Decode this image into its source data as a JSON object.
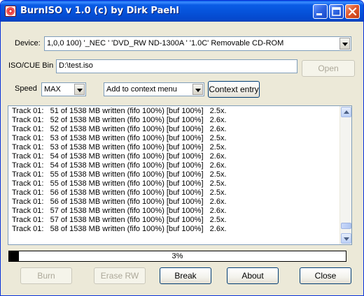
{
  "window": {
    "title": "BurnISO v 1.0 (c) by Dirk Paehl",
    "title_buttons": [
      "minimize-icon",
      "maximize-icon",
      "close-icon"
    ]
  },
  "device": {
    "label": "Device:",
    "selected": "1,0,0 100) '_NEC     ' 'DVD_RW ND-1300A ' '1.0C' Removable CD-ROM"
  },
  "iso": {
    "label": "ISO/CUE Bin",
    "value": "D:\\test.iso",
    "open_label": "Open"
  },
  "speed": {
    "label": "Speed",
    "selected": "MAX"
  },
  "context": {
    "selected": "Add to context menu",
    "entry_label": "Context entry"
  },
  "log": {
    "lines": [
      "Track 01:   51 of 1538 MB written (fifo 100%) [buf 100%]   2.5x.",
      "Track 01:   52 of 1538 MB written (fifo 100%) [buf 100%]   2.6x.",
      "Track 01:   52 of 1538 MB written (fifo 100%) [buf 100%]   2.6x.",
      "Track 01:   53 of 1538 MB written (fifo 100%) [buf 100%]   2.5x.",
      "Track 01:   53 of 1538 MB written (fifo 100%) [buf 100%]   2.5x.",
      "Track 01:   54 of 1538 MB written (fifo 100%) [buf 100%]   2.6x.",
      "Track 01:   54 of 1538 MB written (fifo 100%) [buf 100%]   2.6x.",
      "Track 01:   55 of 1538 MB written (fifo 100%) [buf 100%]   2.5x.",
      "Track 01:   55 of 1538 MB written (fifo 100%) [buf 100%]   2.5x.",
      "Track 01:   56 of 1538 MB written (fifo 100%) [buf 100%]   2.5x.",
      "Track 01:   56 of 1538 MB written (fifo 100%) [buf 100%]   2.6x.",
      "Track 01:   57 of 1538 MB written (fifo 100%) [buf 100%]   2.6x.",
      "Track 01:   57 of 1538 MB written (fifo 100%) [buf 100%]   2.5x.",
      "Track 01:   58 of 1538 MB written (fifo 100%) [buf 100%]   2.6x."
    ],
    "scroll_position": 0.97
  },
  "progress": {
    "text": "3%",
    "fraction": 0.03
  },
  "buttons": {
    "burn": "Burn",
    "erase": "Erase RW",
    "break": "Break",
    "about": "About",
    "close": "Close"
  },
  "colors": {
    "title_bar": "#0551d8",
    "window_bg": "#ece9d8",
    "close_button": "#e0582c",
    "progress_fill": "#000000"
  }
}
